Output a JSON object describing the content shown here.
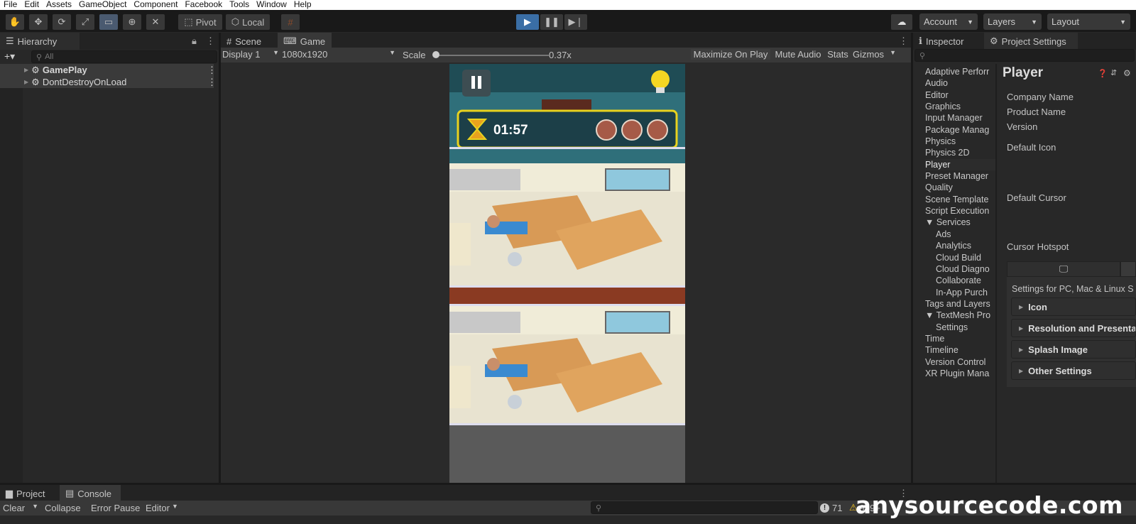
{
  "menu": [
    "File",
    "Edit",
    "Assets",
    "GameObject",
    "Component",
    "Facebook",
    "Tools",
    "Window",
    "Help"
  ],
  "toolbar": {
    "pivot": "Pivot",
    "local": "Local",
    "account": "Account",
    "layers": "Layers",
    "layout": "Layout"
  },
  "hierarchy": {
    "title": "Hierarchy",
    "search_placeholder": "All",
    "items": [
      "GamePlay",
      "DontDestroyOnLoad"
    ]
  },
  "game_tabs": {
    "scene": "Scene",
    "game": "Game"
  },
  "game_toolbar": {
    "display": "Display 1",
    "resolution": "1080x1920",
    "scale_label": "Scale",
    "scale_value": "0.37x",
    "maximize": "Maximize On Play",
    "mute": "Mute Audio",
    "stats": "Stats",
    "gizmos": "Gizmos"
  },
  "game": {
    "timer": "01:57",
    "lives_count": 3
  },
  "inspector": {
    "tab": "Inspector",
    "project_settings": "Project Settings"
  },
  "settings_list": [
    {
      "label": "Adaptive Perforr"
    },
    {
      "label": "Audio"
    },
    {
      "label": "Editor"
    },
    {
      "label": "Graphics"
    },
    {
      "label": "Input Manager"
    },
    {
      "label": "Package Manag"
    },
    {
      "label": "Physics"
    },
    {
      "label": "Physics 2D"
    },
    {
      "label": "Player",
      "selected": true
    },
    {
      "label": "Preset Manager"
    },
    {
      "label": "Quality"
    },
    {
      "label": "Scene Template"
    },
    {
      "label": "Script Execution"
    },
    {
      "label": "▼ Services"
    },
    {
      "label": "Ads",
      "sub": true
    },
    {
      "label": "Analytics",
      "sub": true
    },
    {
      "label": "Cloud Build",
      "sub": true
    },
    {
      "label": "Cloud Diagno",
      "sub": true
    },
    {
      "label": "Collaborate",
      "sub": true
    },
    {
      "label": "In-App Purch",
      "sub": true
    },
    {
      "label": "Tags and Layers"
    },
    {
      "label": "▼ TextMesh Pro"
    },
    {
      "label": "Settings",
      "sub": true
    },
    {
      "label": "Time"
    },
    {
      "label": "Timeline"
    },
    {
      "label": "Version Control"
    },
    {
      "label": "XR Plugin Mana"
    }
  ],
  "player": {
    "title": "Player",
    "company": "Company Name",
    "product": "Product Name",
    "version": "Version",
    "default_icon": "Default Icon",
    "default_cursor": "Default Cursor",
    "cursor_hotspot": "Cursor Hotspot",
    "platform_settings": "Settings for PC, Mac & Linux S",
    "sections": [
      "Icon",
      "Resolution and Presentat",
      "Splash Image",
      "Other Settings"
    ]
  },
  "bottom": {
    "project_tab": "Project",
    "console_tab": "Console",
    "clear": "Clear",
    "collapse": "Collapse",
    "error_pause": "Error Pause",
    "editor": "Editor",
    "count_info": "71",
    "count_warn": "999+"
  },
  "watermark": "anysourcecode.com",
  "colors": {
    "accent": "#4a8ed8",
    "selection": "#2c5d87",
    "hud_yellow": "#e8d21e"
  }
}
